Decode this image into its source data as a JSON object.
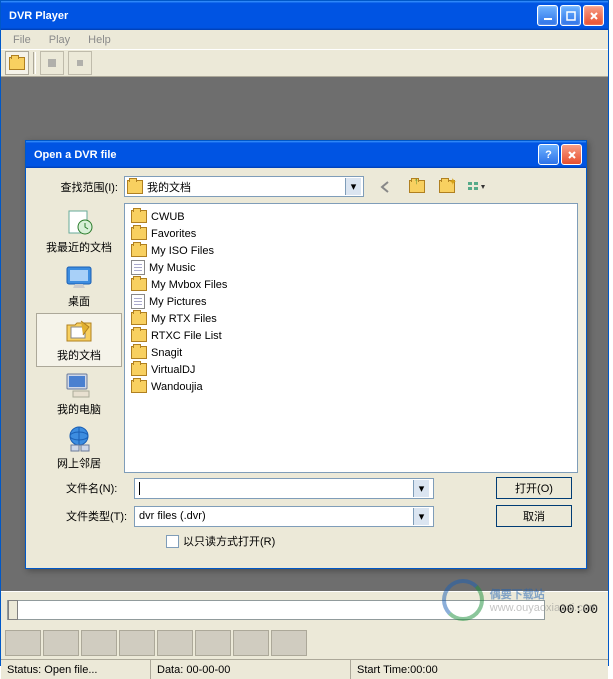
{
  "window": {
    "title": "DVR Player"
  },
  "menu": {
    "file": "File",
    "play": "Play",
    "help": "Help"
  },
  "timeline": {
    "current": "00:00"
  },
  "status": {
    "msg": "Status: Open file...",
    "data": "Data: 00-00-00",
    "start": "Start Time:00:00"
  },
  "dialog": {
    "title": "Open a DVR file",
    "lookin_label": "查找范围(I):",
    "lookin_value": "我的文档",
    "places": {
      "recent": "我最近的文档",
      "desktop": "桌面",
      "mydocs": "我的文档",
      "mycomputer": "我的电脑",
      "network": "网上邻居"
    },
    "files": [
      {
        "name": "CWUB",
        "type": "folder"
      },
      {
        "name": "Favorites",
        "type": "folder"
      },
      {
        "name": "My ISO Files",
        "type": "folder"
      },
      {
        "name": "My Music",
        "type": "doc"
      },
      {
        "name": "My Mvbox Files",
        "type": "folder"
      },
      {
        "name": "My Pictures",
        "type": "doc"
      },
      {
        "name": "My RTX Files",
        "type": "folder"
      },
      {
        "name": "RTXC File List",
        "type": "folder"
      },
      {
        "name": "Snagit",
        "type": "folder"
      },
      {
        "name": "VirtualDJ",
        "type": "folder"
      },
      {
        "name": "Wandoujia",
        "type": "folder"
      }
    ],
    "filename_label": "文件名(N):",
    "filename_value": "",
    "filetype_label": "文件类型(T):",
    "filetype_value": "dvr files (.dvr)",
    "readonly_label": "以只读方式打开(R)",
    "open_btn": "打开(O)",
    "cancel_btn": "取消"
  },
  "watermark": {
    "brand": "偶要下载站",
    "url": "www.ouyaoxiazai.com"
  }
}
